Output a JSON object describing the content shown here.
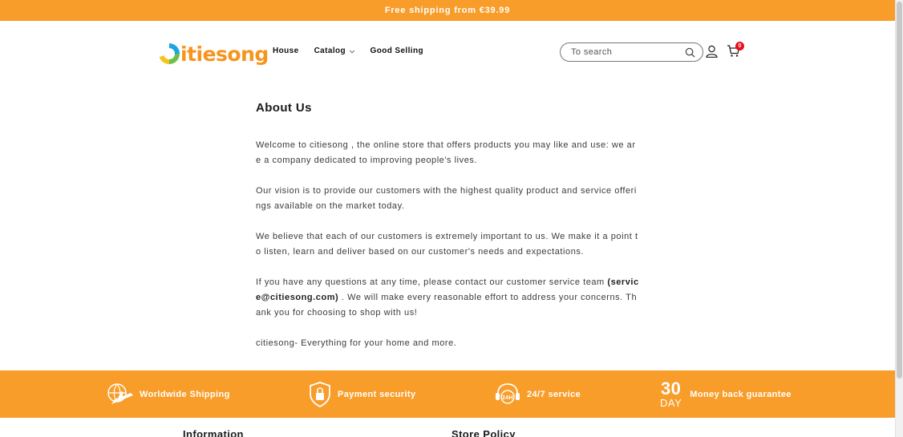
{
  "announcement": "Free shipping from €39.99",
  "logo": {
    "text": "itiesong"
  },
  "nav": [
    {
      "label": "House"
    },
    {
      "label": "Catalog"
    },
    {
      "label": "Good Selling"
    }
  ],
  "search": {
    "placeholder": "To search"
  },
  "cart": {
    "count": "0"
  },
  "page": {
    "title": "About Us",
    "p1": "Welcome to citiesong , the online store that offers products you may like and use: we are a company dedicated to improving people's lives.",
    "p2": "Our vision is to provide our customers with the highest quality product and service offerings available on the market today.",
    "p3": "We believe that each of our customers is extremely important to us. We make it a point to listen, learn and deliver based on our customer's needs and expectations.",
    "p4_before": "If you have any questions at any time, please contact our customer service team ",
    "p4_email": "(service@citiesong.com)",
    "p4_after": " . We will make every reasonable effort to address your concerns. Thank you for choosing to shop with us!",
    "p5": "citiesong- Everything for your home and more."
  },
  "features": [
    {
      "label": "Worldwide Shipping",
      "icon": "plane-globe-icon"
    },
    {
      "label": "Payment security",
      "icon": "shield-lock-icon"
    },
    {
      "label": "24/7 service",
      "icon": "headset-24h-icon",
      "badge": "24H"
    },
    {
      "label": "Money back guarantee",
      "icon": "30-day-icon",
      "num": "30",
      "unit": "DAY"
    }
  ],
  "footer": {
    "col1": "Information",
    "col2": "Store Policy"
  },
  "colors": {
    "accent": "#f99d2a",
    "logo": "#f7941d",
    "badge": "#e3101b"
  }
}
